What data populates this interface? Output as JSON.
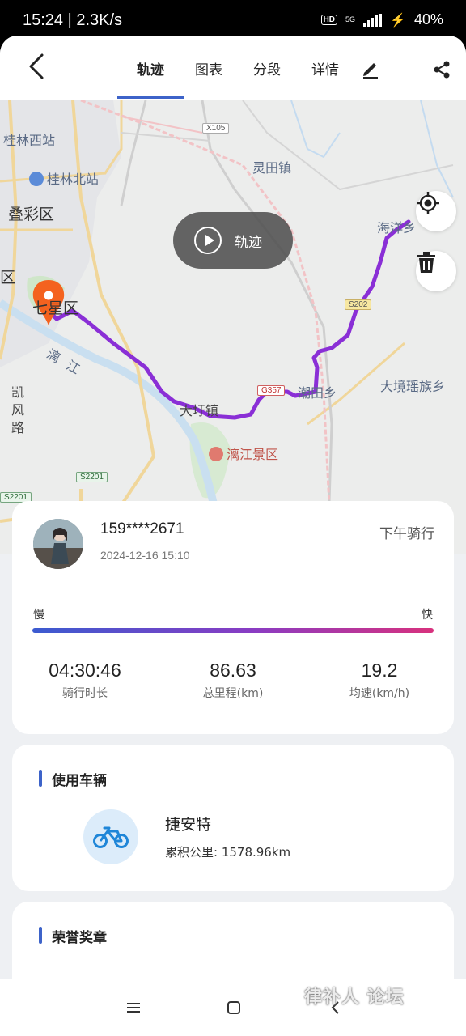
{
  "status_bar": {
    "time": "15:24 | 2.3K/s",
    "net": "5G",
    "battery": "40%"
  },
  "header": {
    "tabs": [
      {
        "label": "轨迹",
        "active": true
      },
      {
        "label": "图表",
        "active": false
      },
      {
        "label": "分段",
        "active": false
      },
      {
        "label": "详情",
        "active": false
      }
    ]
  },
  "map": {
    "playback_label": "轨迹",
    "labels": {
      "guilin_west": "桂林西站",
      "guilin_north": "桂林北站",
      "diecai": "叠彩区",
      "qu_left": "区",
      "qixing": "七星区",
      "lijiang": "漓江",
      "kaifeng": "凯风路",
      "lingtian": "灵田镇",
      "haiyang": "海洋乡",
      "chaotian": "潮田乡",
      "daxu": "大圩镇",
      "dajing": "大境瑶族乡",
      "scenic": "漓江景区"
    },
    "roads": {
      "x105": "X105",
      "s202": "S202",
      "g357": "G357",
      "s2201": "S2201",
      "s2201b": "S2201"
    },
    "colors": {
      "track": "#8a2fd6",
      "pin": "#f4621f"
    }
  },
  "ride": {
    "user": "159****2671",
    "datetime": "2024-12-16 15:10",
    "type": "下午骑行",
    "speed_slow": "慢",
    "speed_fast": "快",
    "stats": [
      {
        "value": "04:30:46",
        "label": "骑行时长"
      },
      {
        "value": "86.63",
        "label": "总里程(km)"
      },
      {
        "value": "19.2",
        "label": "均速(km/h)"
      }
    ]
  },
  "vehicle": {
    "title": "使用车辆",
    "name": "捷安特",
    "mileage": "累积公里: 1578.96km"
  },
  "medal": {
    "title": "荣誉奖章"
  },
  "watermark": "律补人 论坛"
}
